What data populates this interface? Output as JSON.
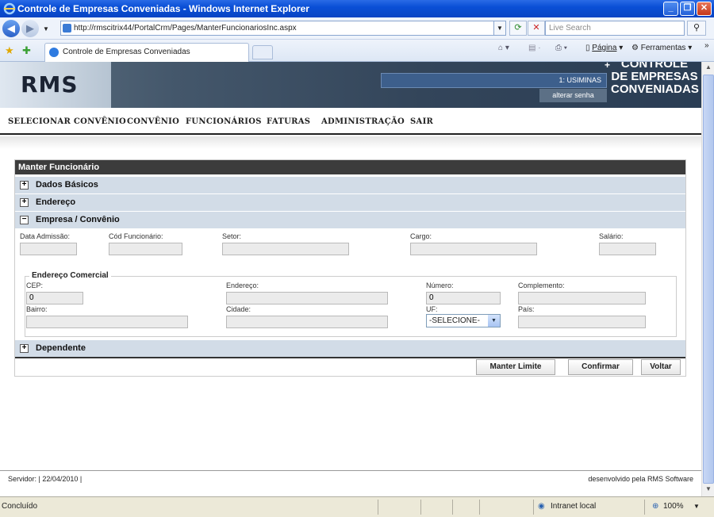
{
  "window": {
    "title": "Controle de Empresas Conveniadas - Windows Internet Explorer"
  },
  "browser": {
    "address": "http://rmscitrix44/PortalCrm/Pages/ManterFuncionariosInc.aspx",
    "search_placeholder": "Live Search",
    "tab_title": "Controle de Empresas Conveniadas",
    "page_menu": "Página",
    "tools_menu": "Ferramentas"
  },
  "header": {
    "logo": "RMS",
    "user": "1: USIMINAS",
    "change_password": "alterar senha",
    "brand_line1": "CONTROLE",
    "brand_line2": "DE EMPRESAS",
    "brand_line3": "CONVENIADAS"
  },
  "menu": [
    "SELECIONAR CONVÊNIO",
    "CONVÊNIO",
    "FUNCIONÁRIOS",
    "FATURAS",
    "ADMINISTRAÇÃO",
    "SAIR"
  ],
  "form": {
    "title": "Manter Funcionário",
    "sections": {
      "dados": "Dados Básicos",
      "endereco": "Endereço",
      "empresa": "Empresa / Convênio",
      "dependente": "Dependente"
    },
    "labels": {
      "admissao": "Data Admissão:",
      "cod": "Cód Funcionário:",
      "setor": "Setor:",
      "cargo": "Cargo:",
      "salario": "Salário:"
    },
    "commercial": {
      "legend": "Endereço Comercial",
      "cep_label": "CEP:",
      "cep_value": "0",
      "endereco_label": "Endereço:",
      "numero_label": "Número:",
      "numero_value": "0",
      "complemento_label": "Complemento:",
      "bairro_label": "Bairro:",
      "cidade_label": "Cidade:",
      "uf_label": "UF:",
      "uf_value": "-SELECIONE-",
      "pais_label": "País:"
    },
    "buttons": {
      "limit": "Manter Limite",
      "confirm": "Confirmar",
      "back": "Voltar"
    }
  },
  "footer": {
    "server": "Servidor:  |  22/04/2010  |",
    "credit": "desenvolvido pela RMS Software"
  },
  "statusbar": {
    "text": "Concluído",
    "zone": "Intranet local",
    "zoom": "100%"
  }
}
